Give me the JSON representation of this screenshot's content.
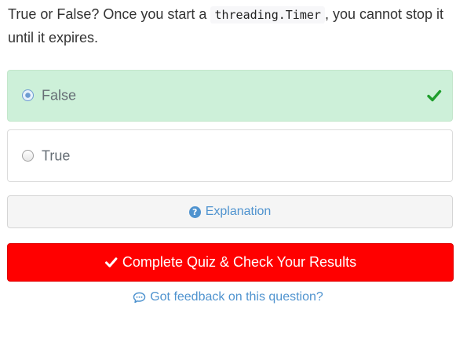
{
  "question": {
    "prefix": "True or False? Once you start a",
    "code": "threading.Timer",
    "suffix": ", you cannot stop it until it expires."
  },
  "options": [
    {
      "label": "False",
      "selected": true,
      "state": "correct",
      "icon": "checkmark-icon"
    },
    {
      "label": "True",
      "selected": false,
      "state": "neutral"
    }
  ],
  "explanation": {
    "label": "Explanation",
    "icon": "question-circle-icon"
  },
  "submit": {
    "label": "Complete Quiz & Check Your Results",
    "icon": "checkmark-icon",
    "color": "#ff0000"
  },
  "feedback": {
    "label": "Got feedback on this question?",
    "icon": "comment-icon"
  },
  "colors": {
    "correct_bg": "#cdf0d9",
    "correct_check": "#1e9e2c",
    "link": "#4f93cf"
  }
}
